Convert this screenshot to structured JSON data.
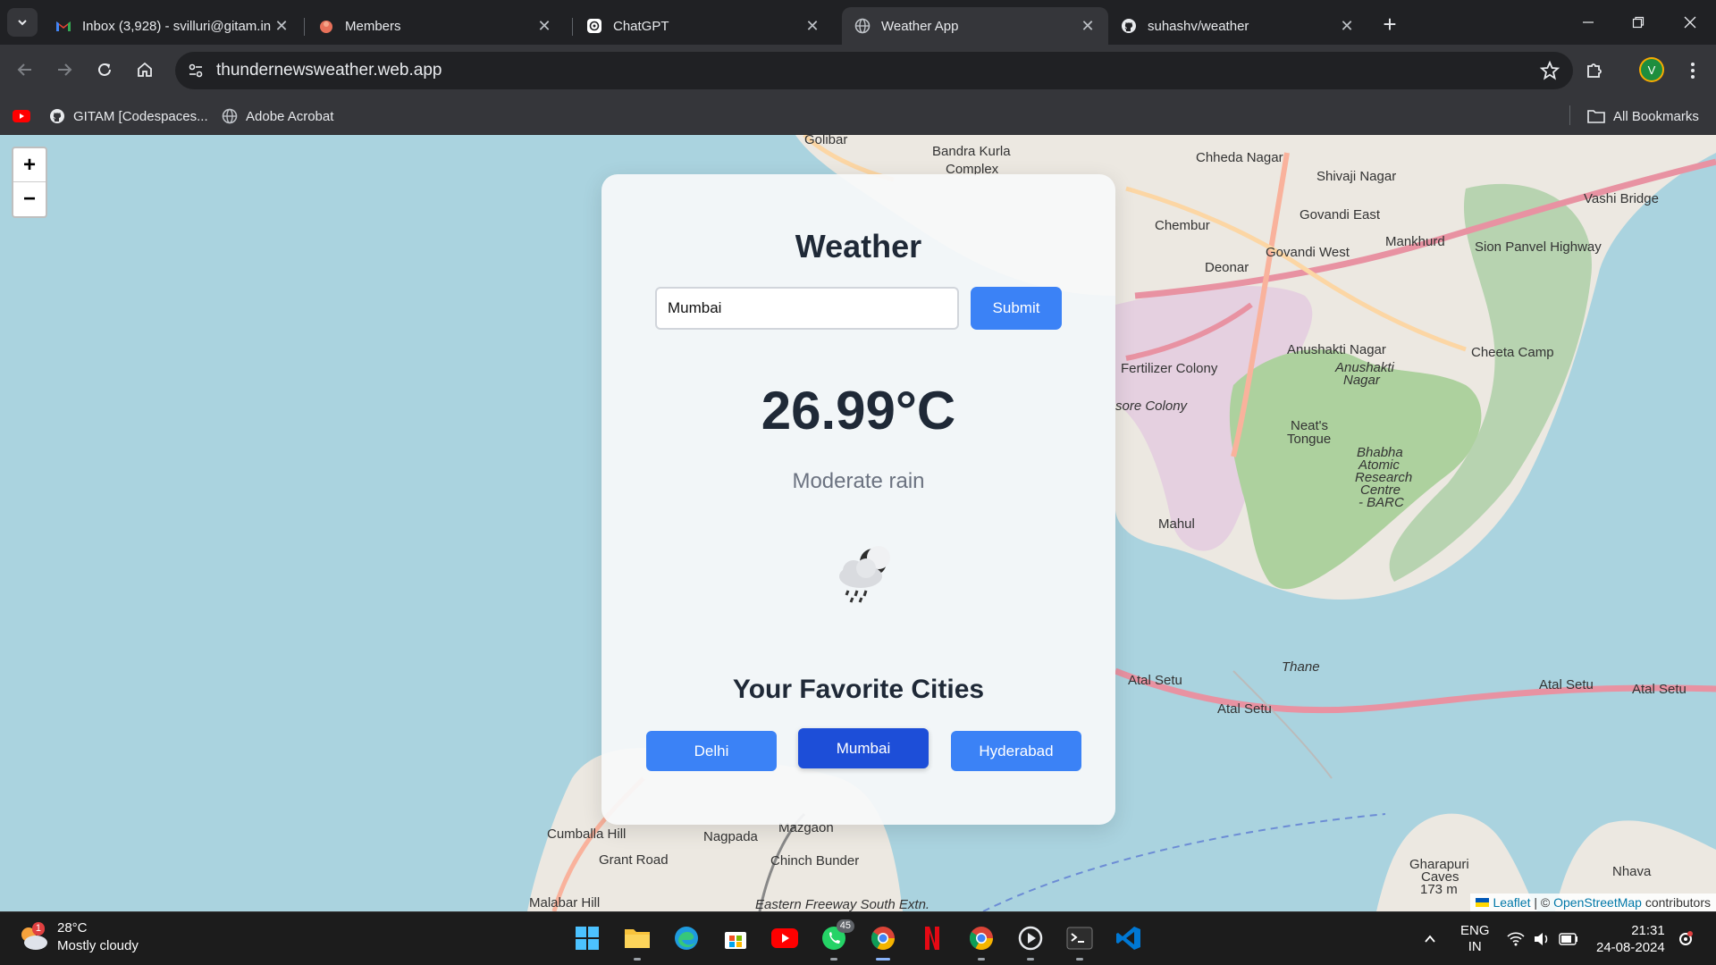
{
  "browser": {
    "tabs": [
      {
        "title": "Inbox (3,928) - svilluri@gitam.in",
        "icon": "gmail-icon",
        "active": false
      },
      {
        "title": "Members",
        "icon": "members-icon",
        "active": false
      },
      {
        "title": "ChatGPT",
        "icon": "chatgpt-icon",
        "active": false
      },
      {
        "title": "Weather App",
        "icon": "globe-icon",
        "active": true
      },
      {
        "title": "suhashv/weather",
        "icon": "github-icon",
        "active": false
      }
    ],
    "url": "thundernewsweather.web.app",
    "profile_initial": "V",
    "bookmarks": [
      {
        "label": "",
        "icon": "youtube-icon"
      },
      {
        "label": "GITAM [Codespaces...",
        "icon": "github-icon"
      },
      {
        "label": "Adobe Acrobat",
        "icon": "globe-icon"
      }
    ],
    "all_bookmarks_label": "All Bookmarks"
  },
  "map": {
    "zoom_in": "+",
    "zoom_out": "−",
    "labels": {
      "goregaon": "Golibar",
      "bkc": "Bandra Kurla",
      "complex": "Complex",
      "chheda": "Chheda Nagar",
      "shivaji": "Shivaji Nagar",
      "vashi_bridge": "Vashi Bridge",
      "chembur": "Chembur",
      "govandi_e": "Govandi East",
      "mankhurd": "Mankhurd",
      "govandi_w": "Govandi West",
      "deonar": "Deonar",
      "sion_panvel": "Sion Panvel Highway",
      "anushakti": "Anushakti Nagar",
      "anushakti2": "Anushakti",
      "anushakti3": "Nagar",
      "cheeta": "Cheeta Camp",
      "fertilizer": "Fertilizer Colony",
      "sore_colony": "sore Colony",
      "neats1": "Neat's",
      "neats2": "Tongue",
      "barc1": "Bhabha",
      "barc2": "Atomic",
      "barc3": "Research",
      "barc4": "Centre",
      "barc5": "- BARC",
      "mahul": "Mahul",
      "thane": "Thane",
      "atal1": "Atal Setu",
      "atal2": "Atal Setu",
      "atal3": "Atal Setu",
      "atal4": "Atal Setu",
      "cumballa": "Cumballa Hill",
      "nagpada": "Nagpada",
      "mazgaon": "Mazgaon",
      "grant": "Grant Road",
      "chinch": "Chinch Bunder",
      "malabar": "Malabar Hill",
      "eastern": "Eastern Freeway South Extn.",
      "gharapuri1": "Gharapuri",
      "gharapuri2": "Caves",
      "gharapuri3": "173 m",
      "nhava": "Nhava"
    },
    "attribution": {
      "leaflet": "Leaflet",
      "sep": " | © ",
      "osm": "OpenStreetMap",
      "contrib": " contributors"
    }
  },
  "weather": {
    "title": "Weather",
    "city_value": "Mumbai",
    "submit_label": "Submit",
    "temperature": "26.99°C",
    "description": "Moderate rain",
    "icon": "cloud-rain-night-icon",
    "favorites_title": "Your Favorite Cities",
    "favorites": [
      "Delhi",
      "Mumbai",
      "Hyderabad"
    ],
    "accent": "#3b82f6"
  },
  "taskbar": {
    "weather_temp": "28°C",
    "weather_desc": "Mostly cloudy",
    "weather_badge": "1",
    "whatsapp_badge": "45",
    "lang": "ENG",
    "region": "IN",
    "time": "21:31",
    "date": "24-08-2024"
  }
}
